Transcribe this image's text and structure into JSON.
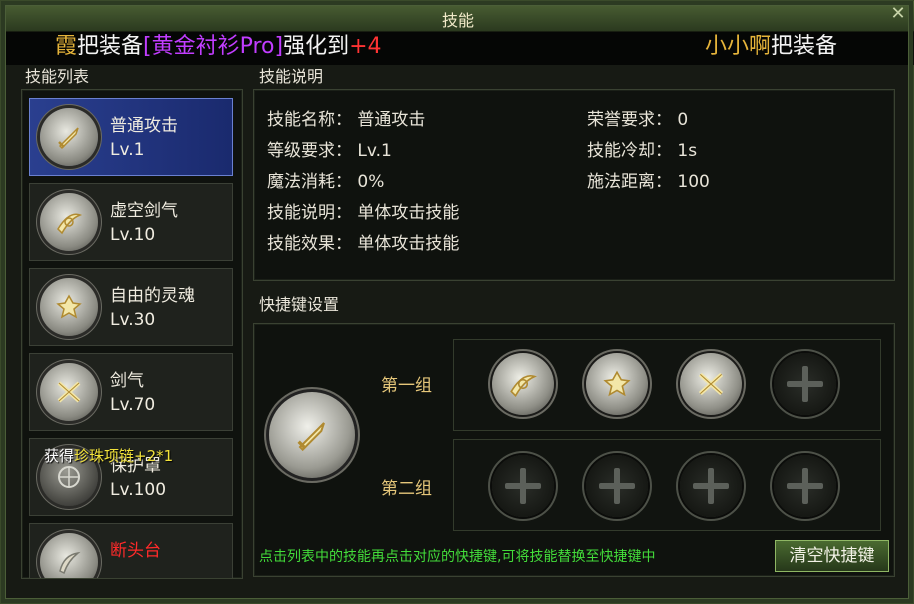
{
  "window": {
    "title": "技能",
    "close_icon": "close-x-icon"
  },
  "marquee": {
    "left": {
      "player": "霞",
      "text1": "把装备",
      "item": "[黄金衬衫Pro]",
      "text2": "强化到",
      "level": "+4"
    },
    "right": {
      "player": "小小啊",
      "text1": "把装备"
    }
  },
  "skill_list": {
    "title": "技能列表",
    "items": [
      {
        "name": "普通攻击",
        "level": "Lv.1",
        "icon": "sword-icon",
        "selected": true
      },
      {
        "name": "虚空剑气",
        "level": "Lv.10",
        "icon": "void-sword-icon"
      },
      {
        "name": "自由的灵魂",
        "level": "Lv.30",
        "icon": "soul-icon"
      },
      {
        "name": "剑气",
        "level": "Lv.70",
        "icon": "sword-aura-icon"
      },
      {
        "name": "保护罩",
        "level": "Lv.100",
        "icon": "shield-icon"
      },
      {
        "name": "断头台",
        "level": "",
        "icon": "guillotine-icon",
        "color": "#ff2a2a"
      }
    ],
    "overlay_message": {
      "prefix": "获得",
      "item": "珍珠项链+2*1"
    }
  },
  "description": {
    "title": "技能说明",
    "rows_left": [
      {
        "label": "技能名称：",
        "value": "普通攻击"
      },
      {
        "label": "等级要求：",
        "value": "Lv.1"
      },
      {
        "label": "魔法消耗：",
        "value": "0%"
      },
      {
        "label": "技能说明：",
        "value": "单体攻击技能"
      },
      {
        "label": "技能效果：",
        "value": "单体攻击技能"
      }
    ],
    "rows_right": [
      {
        "label": "荣誉要求：",
        "value": "0"
      },
      {
        "label": "技能冷却：",
        "value": "1s"
      },
      {
        "label": "施法距离：",
        "value": "100"
      }
    ]
  },
  "shortcuts": {
    "title": "快捷键设置",
    "selected_icon": "sword-icon",
    "groups": [
      {
        "label": "第一组",
        "slots": [
          "void-sword-icon",
          "soul-icon",
          "sword-aura-icon",
          "empty"
        ]
      },
      {
        "label": "第二组",
        "slots": [
          "empty",
          "empty",
          "empty",
          "empty"
        ]
      }
    ],
    "hint": "点击列表中的技能再点击对应的快捷键,可将技能替换至快捷键中",
    "clear_button": "清空快捷键"
  },
  "colors": {
    "gold": "#e6b43a",
    "purple": "#c13dff",
    "red": "#ff3333",
    "hint_green": "#43dc3a",
    "selected_blue": "#2a3f8f"
  }
}
